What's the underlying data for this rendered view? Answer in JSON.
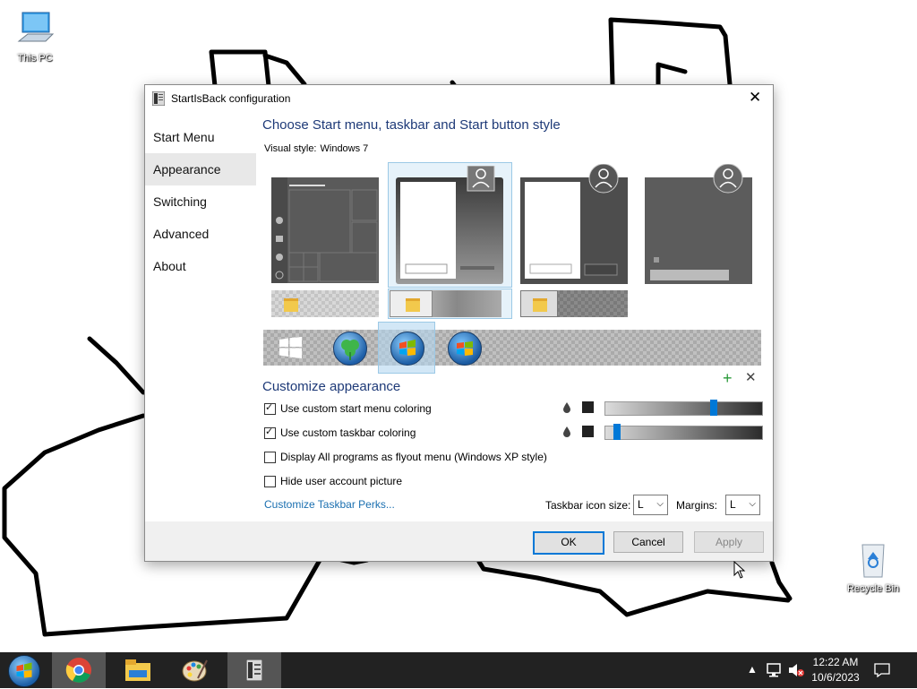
{
  "desktop": {
    "this_pc_label": "This PC",
    "recycle_bin_label": "Recycle Bin"
  },
  "dialog": {
    "title": "StartIsBack configuration",
    "nav": [
      {
        "label": "Start Menu",
        "selected": false
      },
      {
        "label": "Appearance",
        "selected": true
      },
      {
        "label": "Switching",
        "selected": false
      },
      {
        "label": "Advanced",
        "selected": false
      },
      {
        "label": "About",
        "selected": false
      }
    ],
    "heading": "Choose Start menu, taskbar and Start button style",
    "visual_style_label": "Visual style:",
    "visual_style_value": "Windows 7",
    "customize_heading": "Customize appearance",
    "add_icon": "plus-icon",
    "remove_icon": "close-icon",
    "options": [
      {
        "label": "Use custom start menu coloring",
        "checked": true
      },
      {
        "label": "Use custom taskbar coloring",
        "checked": true
      },
      {
        "label": "Display All programs as flyout menu (Windows XP style)",
        "checked": false
      },
      {
        "label": "Hide user account picture",
        "checked": false
      }
    ],
    "start_menu_slider_level": 0.67,
    "taskbar_slider_level": 0.05,
    "link_label": "Customize Taskbar Perks...",
    "taskbar_icon_size_label": "Taskbar icon size:",
    "taskbar_icon_size_value": "L",
    "margins_label": "Margins:",
    "margins_value": "L",
    "buttons": {
      "ok": "OK",
      "cancel": "Cancel",
      "apply": "Apply"
    }
  },
  "taskbar": {
    "time": "12:22 AM",
    "date": "10/6/2023"
  },
  "colors": {
    "accent": "#0078d7",
    "heading": "#1e3a78",
    "link": "#1a6fb0",
    "taskbar": "#222222"
  }
}
